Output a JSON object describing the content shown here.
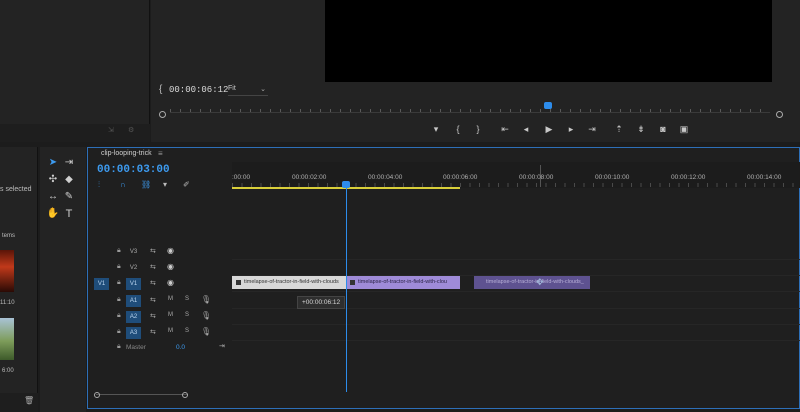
{
  "program": {
    "timecode": "00:00:06:12",
    "fit_label": "Fit",
    "transport": [
      "marker-icon",
      "mark-in-icon",
      "mark-out-icon",
      "go-to-in-icon",
      "step-back-icon",
      "play-icon",
      "step-forward-icon",
      "go-to-out-icon",
      "lift-icon",
      "extract-icon",
      "export-frame-icon",
      "compare-icon"
    ]
  },
  "project": {
    "selected_text": "s selected",
    "items_text": "tems",
    "clip1_duration": "11:10",
    "clip2_duration": "6:00"
  },
  "timeline": {
    "tab": "clip-looping-trick",
    "timecode": "00:00:03:00",
    "ruler": [
      ":00:00",
      "00:00:02:00",
      "00:00:04:00",
      "00:00:06:00",
      "00:00:08:00",
      "00:00:10:00",
      "00:00:12:00",
      "00:00:14:00"
    ],
    "tooltip": "+00:00:06:12",
    "tracks": [
      {
        "name": "V3",
        "kind": "video"
      },
      {
        "name": "V2",
        "kind": "video"
      },
      {
        "name": "V1",
        "kind": "video",
        "patch": "V1"
      },
      {
        "name": "A1",
        "kind": "audio"
      },
      {
        "name": "A2",
        "kind": "audio"
      },
      {
        "name": "A3",
        "kind": "audio"
      }
    ],
    "master_label": "Master",
    "master_value": "0.0",
    "clips": [
      "timelapse-of-tractor-in-field-with-clouds",
      "timelapse-of-tractor-in-field-with-clou",
      "timelapse-of-tractor-in-field-with-clouds_"
    ]
  },
  "colors": {
    "accent": "#2d8ceb",
    "work_area": "#d9cf3a",
    "clip_selected": "#9f8bd8"
  }
}
